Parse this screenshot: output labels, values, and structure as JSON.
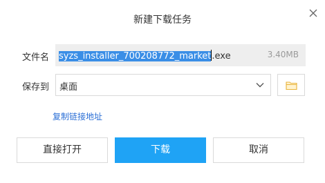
{
  "dialog": {
    "title": "新建下载任务",
    "close_icon": "close-icon"
  },
  "filename": {
    "label": "文件名",
    "selected_text": "syzs_installer_700208772_market",
    "unselected_text": ".exe",
    "size": "3.40MB"
  },
  "saveto": {
    "label": "保存到",
    "value": "桌面",
    "dropdown_icon": "chevron-down-icon",
    "browse_icon": "folder-icon"
  },
  "copy_link": {
    "label": "复制链接地址"
  },
  "buttons": {
    "open_directly": "直接打开",
    "download": "下载",
    "cancel": "取消"
  },
  "colors": {
    "primary": "#1fa3f5",
    "link": "#2b6fd6",
    "selection": "#3a8ee6",
    "folder": "#f6c343"
  }
}
